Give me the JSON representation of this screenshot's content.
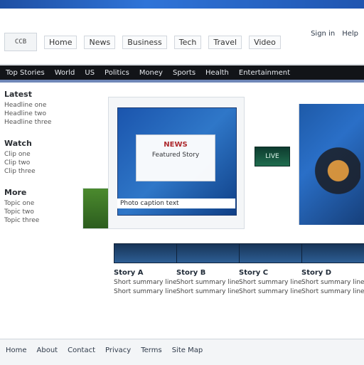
{
  "window": {
    "top_strip_color": "#2f74d8"
  },
  "topbar": {
    "logo_text": "CCB",
    "nav": [
      "Home",
      "News",
      "Business",
      "Tech",
      "Travel",
      "Video"
    ],
    "links": [
      "Sign in",
      "Help"
    ]
  },
  "navbar": {
    "menu": [
      "Top Stories",
      "World",
      "US",
      "Politics",
      "Money",
      "Sports",
      "Health",
      "Entertainment"
    ]
  },
  "sidebar": {
    "blocks": [
      {
        "title": "Latest",
        "lines": [
          "Headline one",
          "Headline two",
          "Headline three"
        ]
      },
      {
        "title": "Watch",
        "lines": [
          "Clip one",
          "Clip two",
          "Clip three"
        ]
      },
      {
        "title": "More",
        "lines": [
          "Topic one",
          "Topic two",
          "Topic three"
        ]
      }
    ]
  },
  "feature": {
    "card_title": "NEWS",
    "card_sub": "Featured Story",
    "caption": "Photo caption text"
  },
  "mid_badge": "LIVE",
  "cards": [
    {
      "title": "Story A",
      "lines": [
        "Short summary line",
        "Short summary line"
      ]
    },
    {
      "title": "Story B",
      "lines": [
        "Short summary line",
        "Short summary line"
      ]
    },
    {
      "title": "Story C",
      "lines": [
        "Short summary line",
        "Short summary line"
      ]
    },
    {
      "title": "Story D",
      "lines": [
        "Short summary line",
        "Short summary line"
      ]
    }
  ],
  "footer": {
    "links": [
      "Home",
      "About",
      "Contact",
      "Privacy",
      "Terms",
      "Site Map"
    ]
  }
}
